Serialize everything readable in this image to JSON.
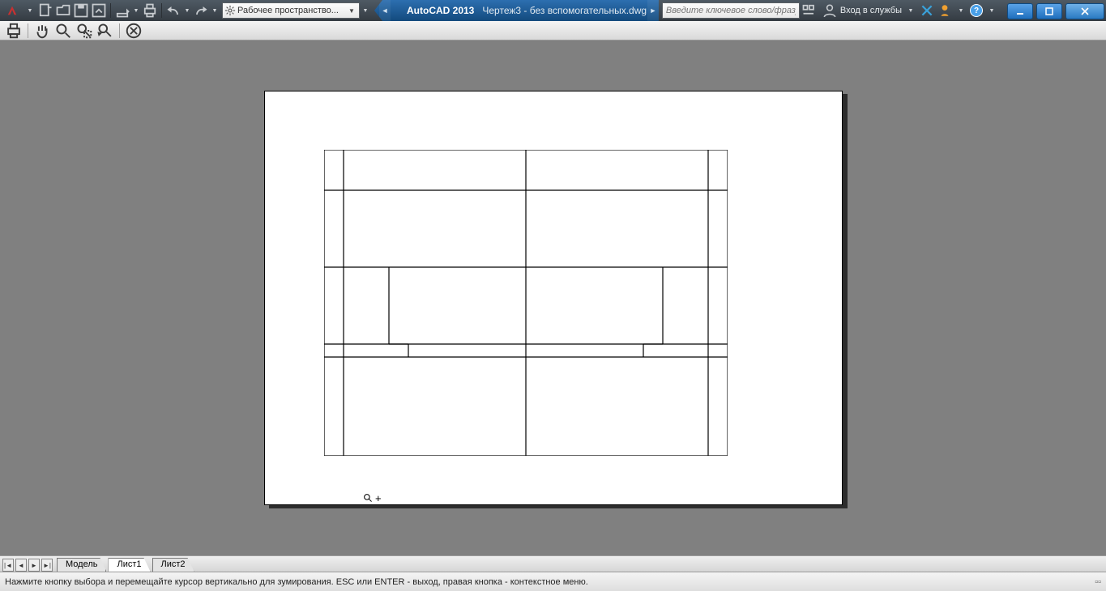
{
  "titlebar": {
    "workspace_label": "Рабочее пространство...",
    "app_name": "AutoCAD 2013",
    "doc_name": "Чертеж3 - без вспомогательных.dwg",
    "search_placeholder": "Введите ключевое слово/фразу",
    "signin_label": "Вход в службы"
  },
  "tabs": {
    "model": "Модель",
    "sheet1": "Лист1",
    "sheet2": "Лист2"
  },
  "status": {
    "prompt": "Нажмите кнопку выбора и перемещайте курсор вертикально для зумирования. ESC или ENTER - выход, правая кнопка - контекстное меню."
  }
}
